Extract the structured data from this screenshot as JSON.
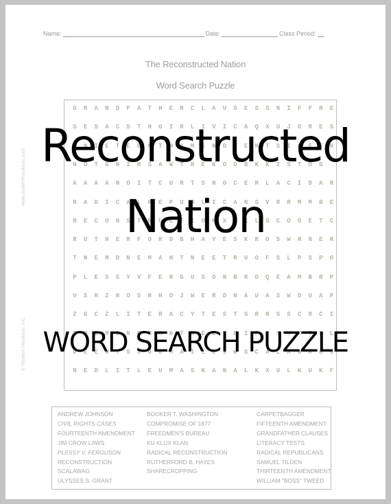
{
  "header": {
    "name_label": "Name:",
    "date_label": "Date:",
    "class_period_label": "Class Period:"
  },
  "title": {
    "line1": "The Reconstructed Nation",
    "line2": "Word Search Puzzle"
  },
  "watermarks": {
    "website": "www.studenthandouts.com",
    "copyright": "© Student Handouts, Inc."
  },
  "grid": {
    "rows": [
      "GRANDFATHERCLAUSESSNIFFRE",
      "SESACSTHGIRLIVICAQXUJORES",
      "TNIETEENTHAMENDMENTSIEEEH",
      "NOTGNIHSAWTREKOOBKKISTOG",
      "AAAANOITCURTSNOCERLACIDAR",
      "RADICALREPUBLICANSVRRMMBE",
      "RECONSTRUCTIONXXXLSCOOETC",
      "RUTHERFORDBHAYESKROSWRNER",
      "TNEMDNEMAHTNEETRUOFSLPSPO",
      "PLESSYVFERGUSONBRDQEAMBRP",
      "VSHZNOSNHOJWERDNAUASWOUAP",
      "ZGCZLITERACYTESTSRNSSCRCI",
      "TNEMDNEMAHTNEETFIFFYYXTLL",
      "DEEWTSSOBMAILLIWSCALAWAGG",
      "NEDLITLEUMASKANALKXULKUKF"
    ]
  },
  "word_list": {
    "columns": [
      [
        {
          "text": "ANDREW JOHNSON",
          "italic": false
        },
        {
          "text": "CIVIL RIGHTS CASES",
          "italic": true
        },
        {
          "text": "FOURTEENTH AMENDMENT",
          "italic": false
        },
        {
          "text": "JIM CROW LAWS",
          "italic": false
        },
        {
          "text": "PLESSY V. FERGUSON",
          "italic": true
        },
        {
          "text": "RECONSTRUCTION",
          "italic": false
        },
        {
          "text": "SCALAWAG",
          "italic": false
        },
        {
          "text": "ULYSSES S. GRANT",
          "italic": false
        }
      ],
      [
        {
          "text": "BOOKER T. WASHINGTON",
          "italic": false
        },
        {
          "text": "COMPROMISE OF 1877",
          "italic": false
        },
        {
          "text": "FREEDMEN'S BUREAU",
          "italic": false
        },
        {
          "text": "KU KLUX KLAN",
          "italic": false
        },
        {
          "text": "RADICAL RECONSTRUCTION",
          "italic": false
        },
        {
          "text": "RUTHERFORD B. HAYES",
          "italic": false
        },
        {
          "text": "SHARECROPPING",
          "italic": false
        }
      ],
      [
        {
          "text": "CARPETBAGGER",
          "italic": false
        },
        {
          "text": "FIFTEENTH AMENDMENT",
          "italic": false
        },
        {
          "text": "GRANDFATHER CLAUSES",
          "italic": false
        },
        {
          "text": "LITERACY TESTS",
          "italic": false
        },
        {
          "text": "RADICAL REPUBLICANS",
          "italic": false
        },
        {
          "text": "SAMUEL TILDEN",
          "italic": false
        },
        {
          "text": " THIRTEENTH AMENDMENT",
          "italic": false
        },
        {
          "text": "WILLIAM \"BOSS\" TWEED",
          "italic": false
        }
      ]
    ]
  },
  "overlay": {
    "line1": "Reconstructed",
    "line2": "Nation",
    "line3": "WORD SEARCH PUZZLE"
  }
}
